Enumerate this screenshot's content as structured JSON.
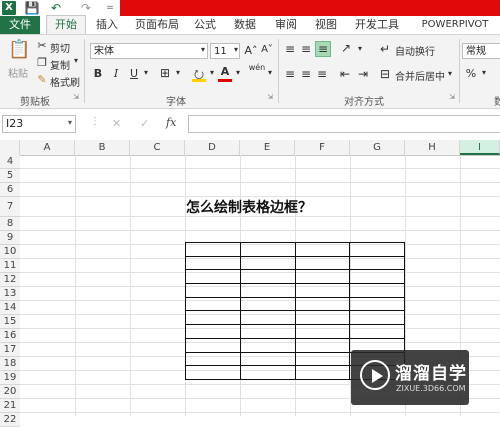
{
  "titlebar": {
    "logo": "X",
    "qa_save": "💾",
    "qa_undo": "↶",
    "qa_redo": "↷",
    "qa_more": "="
  },
  "tabs": [
    {
      "id": "file",
      "label": "文件"
    },
    {
      "id": "home",
      "label": "开始"
    },
    {
      "id": "insert",
      "label": "插入"
    },
    {
      "id": "layout",
      "label": "页面布局"
    },
    {
      "id": "formulas",
      "label": "公式"
    },
    {
      "id": "data",
      "label": "数据"
    },
    {
      "id": "review",
      "label": "审阅"
    },
    {
      "id": "view",
      "label": "视图"
    },
    {
      "id": "developer",
      "label": "开发工具"
    },
    {
      "id": "powerpivot",
      "label": "POWERPIVOT"
    }
  ],
  "ribbon": {
    "clipboard": {
      "paste_label": "粘贴",
      "cut_label": "剪切",
      "copy_label": "复制",
      "format_painter_label": "格式刷",
      "group_label": "剪贴板"
    },
    "font": {
      "font_name": "宋体",
      "font_size": "11",
      "grow": "A˄",
      "shrink": "A˅",
      "bold": "B",
      "italic": "I",
      "underline": "U",
      "wen": "wén",
      "group_label": "字体"
    },
    "alignment": {
      "wrap_label": "自动换行",
      "merge_label": "合并后居中",
      "group_label": "对齐方式"
    },
    "number": {
      "format_value": "常规",
      "percent": "%",
      "group_label": "数"
    }
  },
  "formula_bar": {
    "name_box": "I23",
    "cancel": "✕",
    "enter": "✓",
    "fx": "fx",
    "formula": ""
  },
  "sheet": {
    "columns": [
      "A",
      "B",
      "C",
      "D",
      "E",
      "F",
      "G",
      "H",
      "I"
    ],
    "selected_column": "I",
    "rows": [
      "4",
      "5",
      "6",
      "7",
      "8",
      "9",
      "10",
      "11",
      "12",
      "13",
      "14",
      "15",
      "16",
      "17",
      "18",
      "19",
      "20",
      "21",
      "22"
    ],
    "heading_text": "怎么绘制表格边框？",
    "drawn_table": {
      "rows": 10,
      "cols": 4
    }
  },
  "watermark": {
    "brand": "溜溜自学",
    "url": "ZIXUE.3D66.COM"
  },
  "colors": {
    "excel_green": "#217346",
    "titlebar_red": "#e00a0a"
  }
}
